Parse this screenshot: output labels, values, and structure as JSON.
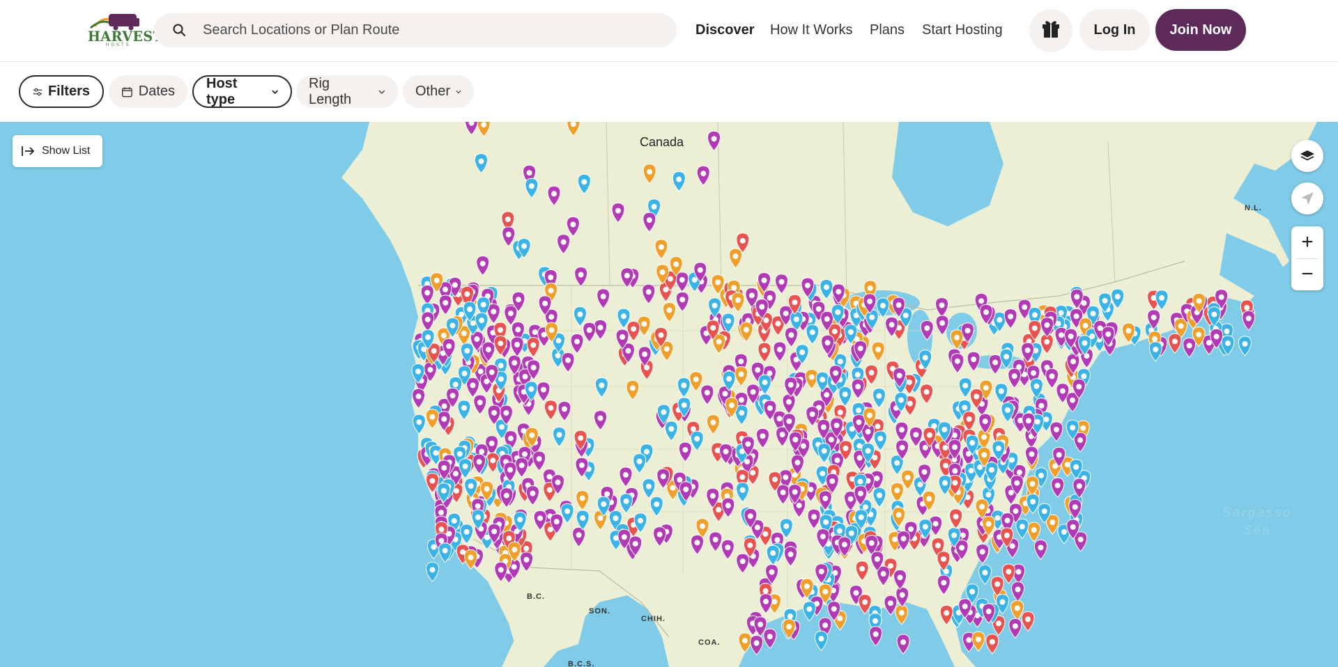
{
  "brand": {
    "name": "HARVEST",
    "sub": "HOSTS"
  },
  "search": {
    "placeholder": "Search Locations or Plan Route"
  },
  "nav": {
    "discover": "Discover",
    "how_it_works": "How It Works",
    "plans": "Plans",
    "start_hosting": "Start Hosting"
  },
  "auth": {
    "login": "Log In",
    "join": "Join Now"
  },
  "filters": {
    "filters": "Filters",
    "dates": "Dates",
    "host_type": "Host type",
    "rig_length": "Rig Length",
    "other": "Other"
  },
  "map": {
    "show_list": "Show List",
    "labels": {
      "canada": "Canada",
      "nl": "N.L.",
      "bc": "B.C.",
      "son": "SON.",
      "chih": "CHIH.",
      "coa": "COA.",
      "bcs": "B.C.S.",
      "sargasso": "Sargasso",
      "sea": "Sea"
    },
    "zoom_in": "+",
    "zoom_out": "−"
  },
  "colors": {
    "brand_purple": "#5e2a5a",
    "pin_farm": "#b23ab5",
    "pin_museum": "#3bb3e6",
    "pin_brewery": "#f0a02a",
    "pin_winery": "#e8524f",
    "water": "#7fcbe8",
    "land": "#ecefd3"
  },
  "icons": {
    "search": "search-icon",
    "gift": "gift-icon",
    "filters": "sliders-icon",
    "dates": "calendar-icon",
    "layers": "layers-icon",
    "locate": "location-arrow-icon",
    "show_list": "arrow-right-bar-icon"
  }
}
